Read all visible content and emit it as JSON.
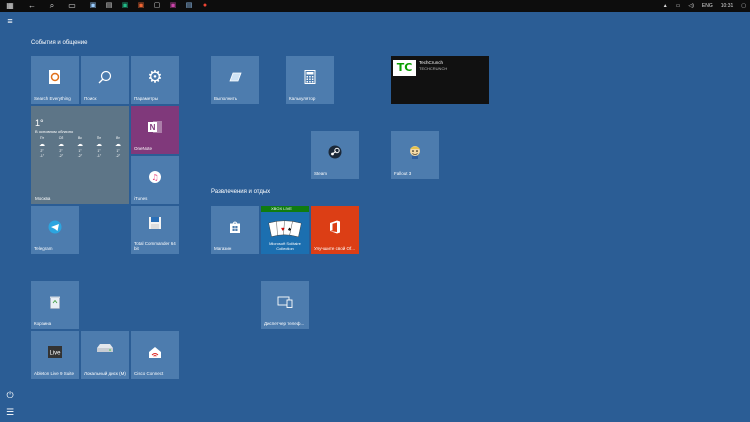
{
  "taskbar": {
    "tray": {
      "language": "ENG",
      "time": "10:31"
    }
  },
  "groups": {
    "events": "События и общение",
    "entertainment": "Развлечения и отдых"
  },
  "tiles": {
    "search_everything": "Search Everything",
    "search": "Поиск",
    "settings": "Параметры",
    "run": "Выполнить",
    "calculator": "Калькулятор",
    "onenote": "OneNote",
    "itunes": "iTunes",
    "steam": "Steam",
    "fallout": "Fallout 3",
    "telegram": "Telegram",
    "total_commander": "Total Commander 64 bit",
    "store": "Магазин",
    "office": "Улучшите свой Of...",
    "recycle": "Корзина",
    "device_manager": "Диспетчер телеф...",
    "ableton": "Ableton Live 9 Suite",
    "local_disk": "Локальный диск (M)",
    "cisco": "Cisco Connect"
  },
  "weather": {
    "temperature": "1°",
    "condition": "В основном облачно",
    "city": "Москва",
    "days": [
      {
        "name": "Пт",
        "hi": "2°",
        "lo": "-1°"
      },
      {
        "name": "Сб",
        "hi": "2°",
        "lo": "-2°"
      },
      {
        "name": "Вс",
        "hi": "1°",
        "lo": "-2°"
      },
      {
        "name": "Пн",
        "hi": "1°",
        "lo": "-1°"
      },
      {
        "name": "Вт",
        "hi": "1°",
        "lo": "-2°"
      }
    ]
  },
  "techcrunch": {
    "title": "TechCrunch",
    "subtitle": "TECHCRUNCH",
    "logo": "TC"
  },
  "solitaire": {
    "badge": "XBOX LIVE",
    "title": "Microsoft Solitaire Collection"
  },
  "colors": {
    "background": "#2b5d95",
    "tile": "#4d7cae",
    "onenote": "#80397b",
    "office": "#dc3e15",
    "techcrunch_green": "#0a9e01"
  },
  "icons": {
    "menu": "hamburger-icon",
    "power": "power-icon",
    "all_apps": "list-icon"
  }
}
